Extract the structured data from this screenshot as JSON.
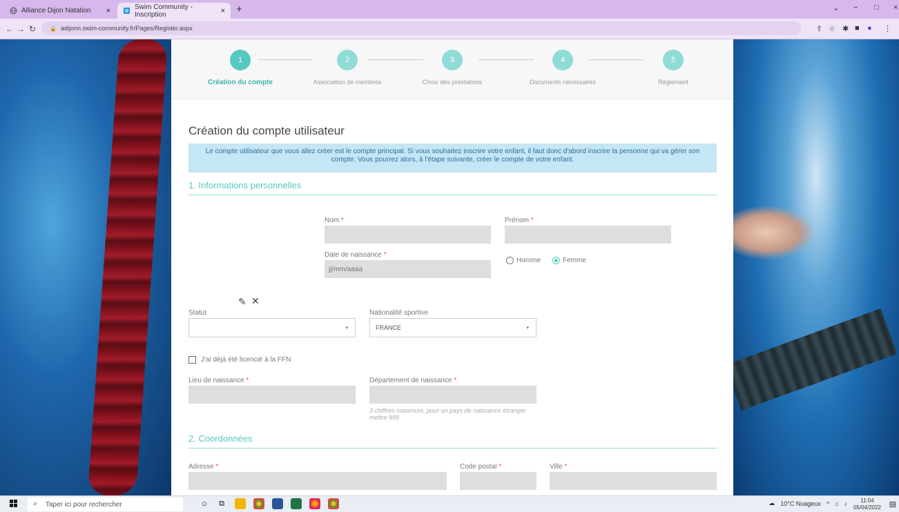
{
  "browser": {
    "tabs": [
      {
        "label": "Alliance Dijon Natation",
        "icon": "globe-icon"
      },
      {
        "label": "Swim Community - Inscription",
        "icon": "site-icon",
        "active": true
      }
    ],
    "new_tab": "+",
    "url": "adijonn.swim-community.fr/Pages/Register.aspx",
    "controls": {
      "minimize": "−",
      "maximize": "□",
      "close": "×"
    }
  },
  "stepper": {
    "steps": [
      {
        "num": "1",
        "label": "Création du compte",
        "active": true
      },
      {
        "num": "2",
        "label": "Association de membres"
      },
      {
        "num": "3",
        "label": "Choix des prestations"
      },
      {
        "num": "4",
        "label": "Documents nécessaires"
      },
      {
        "num": "5",
        "label": "Règlement"
      }
    ]
  },
  "form": {
    "title": "Création du compte utilisateur",
    "info": "Le compte utilisateur que vous allez créer est le compte principal. Si vous souhaitez inscrire votre enfant, il faut donc d'abord inscrire la personne qui va gérer son compte. Vous pourrez alors, à l'étape suivante, créer le compte de votre enfant.",
    "section1": "1. Informations personnelles",
    "nom_label": "Nom",
    "prenom_label": "Prénom",
    "dob_label": "Date de naissance",
    "dob_placeholder": "jj/mm/aaaa",
    "gender_male": "Homme",
    "gender_female": "Femme",
    "gender_selected": "Femme",
    "required_mark": "*",
    "statut_label": "Statut",
    "nationalite_label": "Nationalité sportive",
    "nationalite_value": "FRANCE",
    "ffn_label": "J'ai déjà été licencié à la FFN",
    "lieu_label": "Lieu de naissance",
    "departement_label": "Département de naissance",
    "departement_hint": "3 chiffres maximum, pour un pays de naissance étranger mettre 999",
    "section2": "2. Coordonnées",
    "adresse_label": "Adresse",
    "cp_label": "Code postal",
    "ville_label": "Ville"
  },
  "taskbar": {
    "search_placeholder": "Taper ici pour rechercher",
    "weather": "10°C Nuageux",
    "time": "11:04",
    "date": "05/04/2022"
  }
}
